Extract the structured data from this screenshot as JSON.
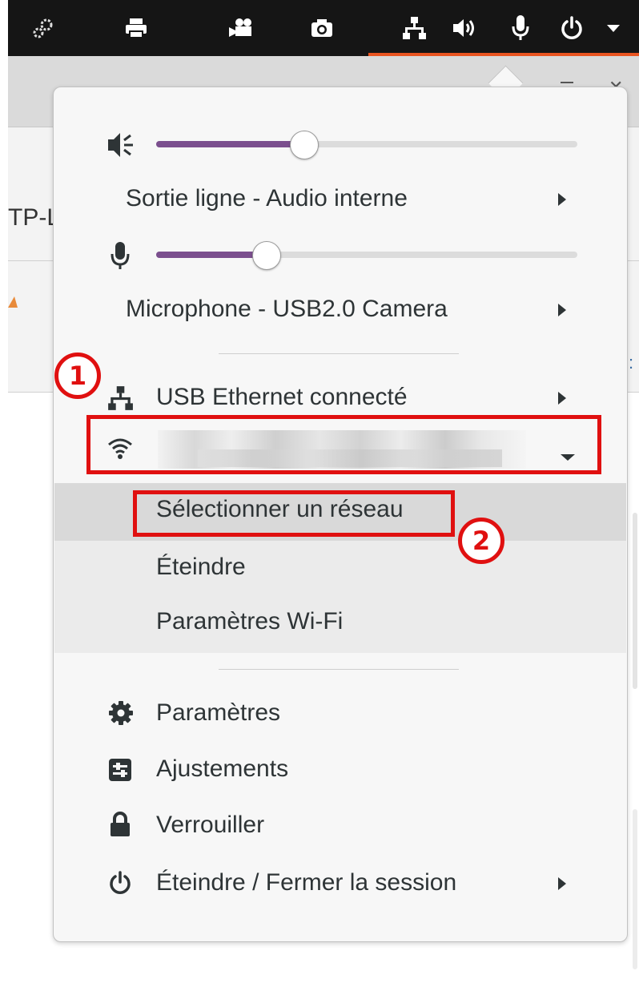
{
  "topbar": {
    "icons": [
      "extensions-icon",
      "printer-icon",
      "video-camera-icon",
      "camera-icon",
      "network-icon",
      "speaker-icon",
      "microphone-icon",
      "power-icon",
      "dropdown-arrow-icon"
    ],
    "accent_color": "#e95420"
  },
  "background": {
    "partial_text": "TP-L"
  },
  "menu": {
    "output": {
      "label": "Sortie ligne - Audio interne",
      "volume_fraction": 0.35,
      "icon": "speaker-icon"
    },
    "input": {
      "label": "Microphone - USB2.0 Camera",
      "volume_fraction": 0.26,
      "icon": "microphone-icon"
    },
    "ethernet": {
      "label": "USB Ethernet connecté",
      "icon": "network-icon"
    },
    "wifi": {
      "label": "",
      "icon": "wifi-icon",
      "submenu": [
        {
          "label": "Sélectionner un réseau"
        },
        {
          "label": "Éteindre"
        },
        {
          "label": "Paramètres Wi-Fi"
        }
      ]
    },
    "system": [
      {
        "label": "Paramètres",
        "icon": "gear-icon"
      },
      {
        "label": "Ajustements",
        "icon": "tweaks-icon"
      },
      {
        "label": "Verrouiller",
        "icon": "lock-icon"
      },
      {
        "label": "Éteindre / Fermer la session",
        "icon": "power-icon"
      }
    ],
    "slider_color": "#7b4f8e"
  },
  "annotations": {
    "step1": "1",
    "step2": "2",
    "color": "#e01010"
  }
}
